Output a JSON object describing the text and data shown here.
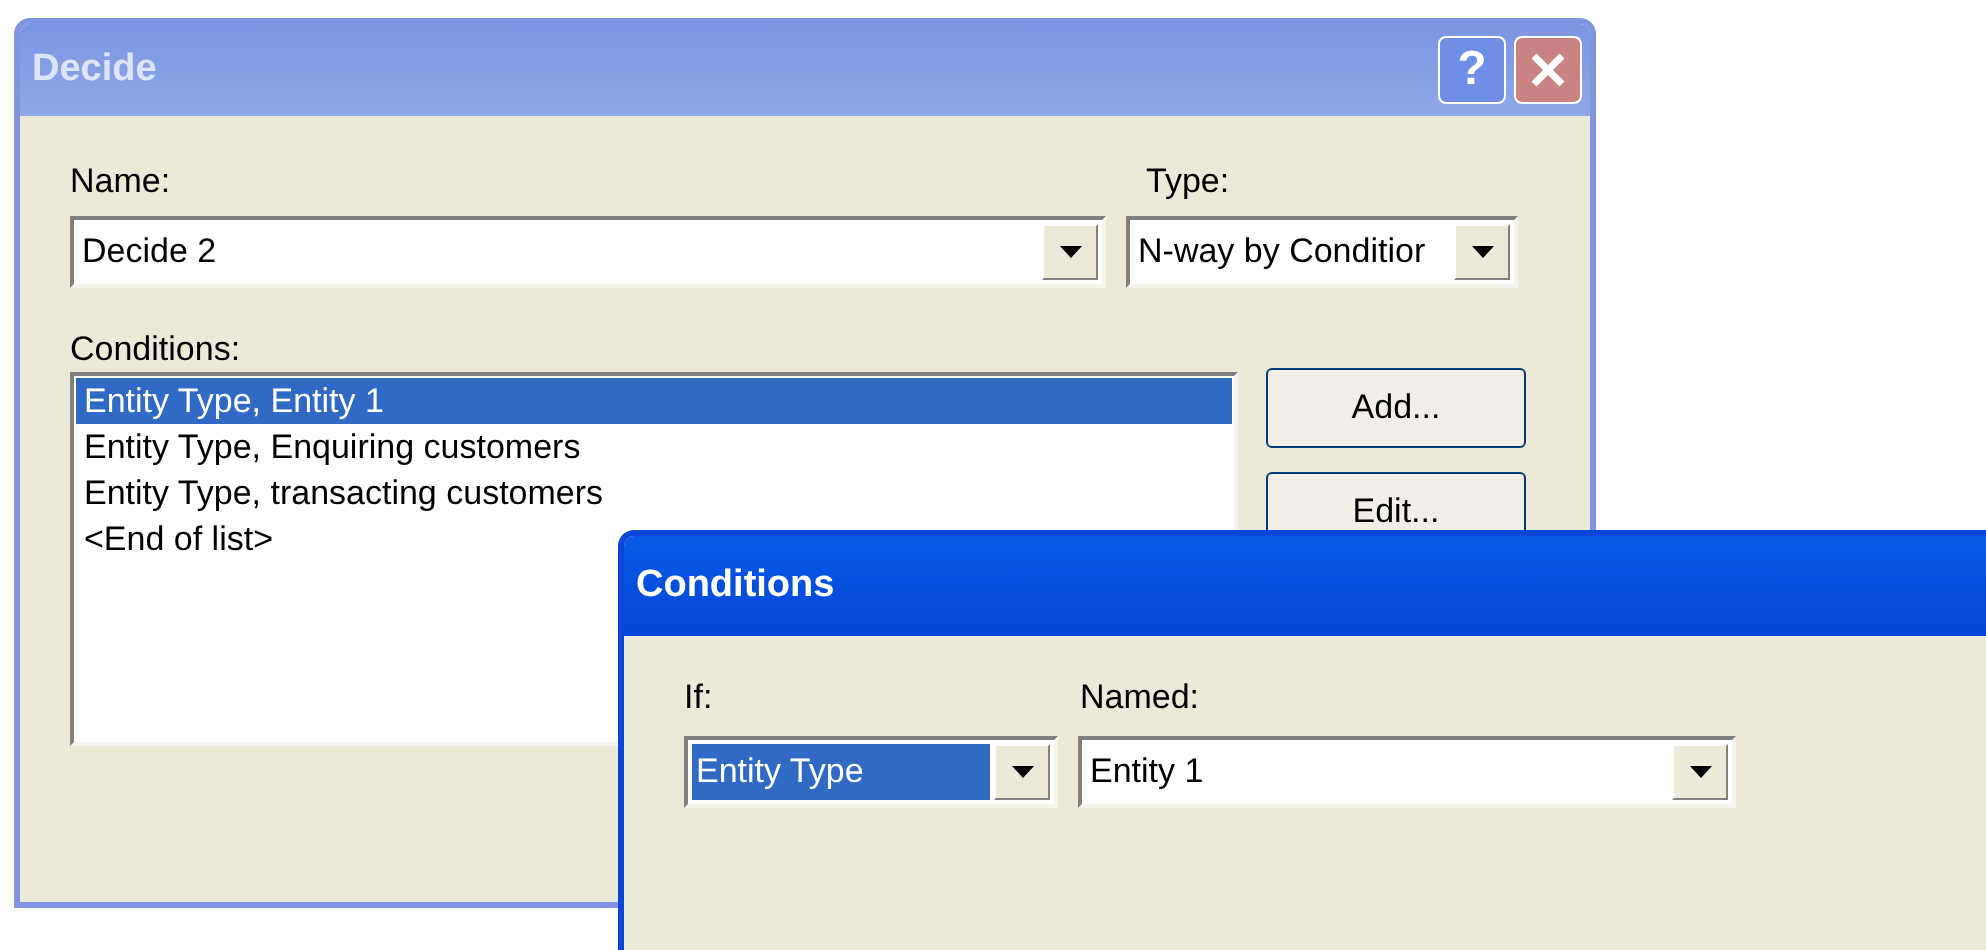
{
  "decide_window": {
    "title": "Decide",
    "active": false,
    "help_button": "?",
    "name_label": "Name:",
    "name_value": "Decide 2",
    "type_label": "Type:",
    "type_value": "N-way by Conditior",
    "conditions_label": "Conditions:",
    "conditions": [
      {
        "text": "Entity Type, Entity 1",
        "selected": true
      },
      {
        "text": "Entity Type, Enquiring customers",
        "selected": false
      },
      {
        "text": "Entity Type, transacting customers",
        "selected": false
      },
      {
        "text": "<End of list>",
        "selected": false
      }
    ],
    "buttons": [
      "Add...",
      "Edit..."
    ]
  },
  "conditions_dialog": {
    "title": "Conditions",
    "active": true,
    "if_label": "If:",
    "if_value": "Entity Type",
    "if_selected": true,
    "named_label": "Named:",
    "named_value": "Entity 1",
    "named_selected": false
  }
}
